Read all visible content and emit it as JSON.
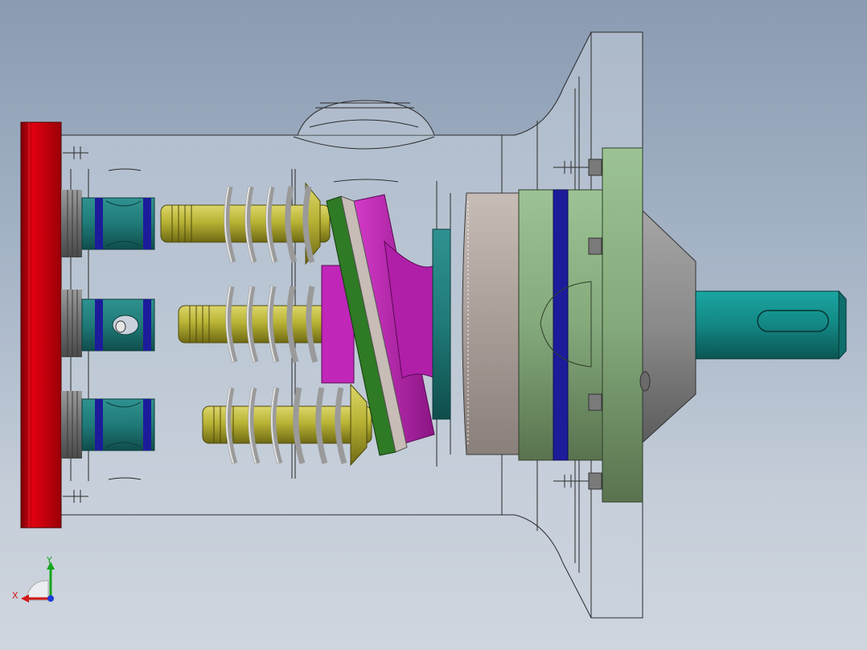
{
  "viewport": {
    "background_top": "#8a9bb2",
    "background_bottom": "#d0d6df"
  },
  "model": {
    "colors": {
      "end_cap": "#c8000a",
      "housing": "#c9d2dc",
      "piston_barrel": "#1f7a78",
      "seal_ring": "#1c1c9a",
      "piston_rod": "#b9b335",
      "spring": "#c8c8c8",
      "swash_plate": "#c026b8",
      "thrust_ring": "#2f7a24",
      "bearing": "#b7aca6",
      "bearing_carrier": "#8fb58a",
      "flange": "#8fac80",
      "cone": "#8c8c8c",
      "shaft": "#138783"
    }
  },
  "triad": {
    "x_label": "X",
    "y_label": "Y",
    "x_color": "#d11919",
    "y_color": "#16a51e",
    "z_color": "#1c3bd6"
  }
}
